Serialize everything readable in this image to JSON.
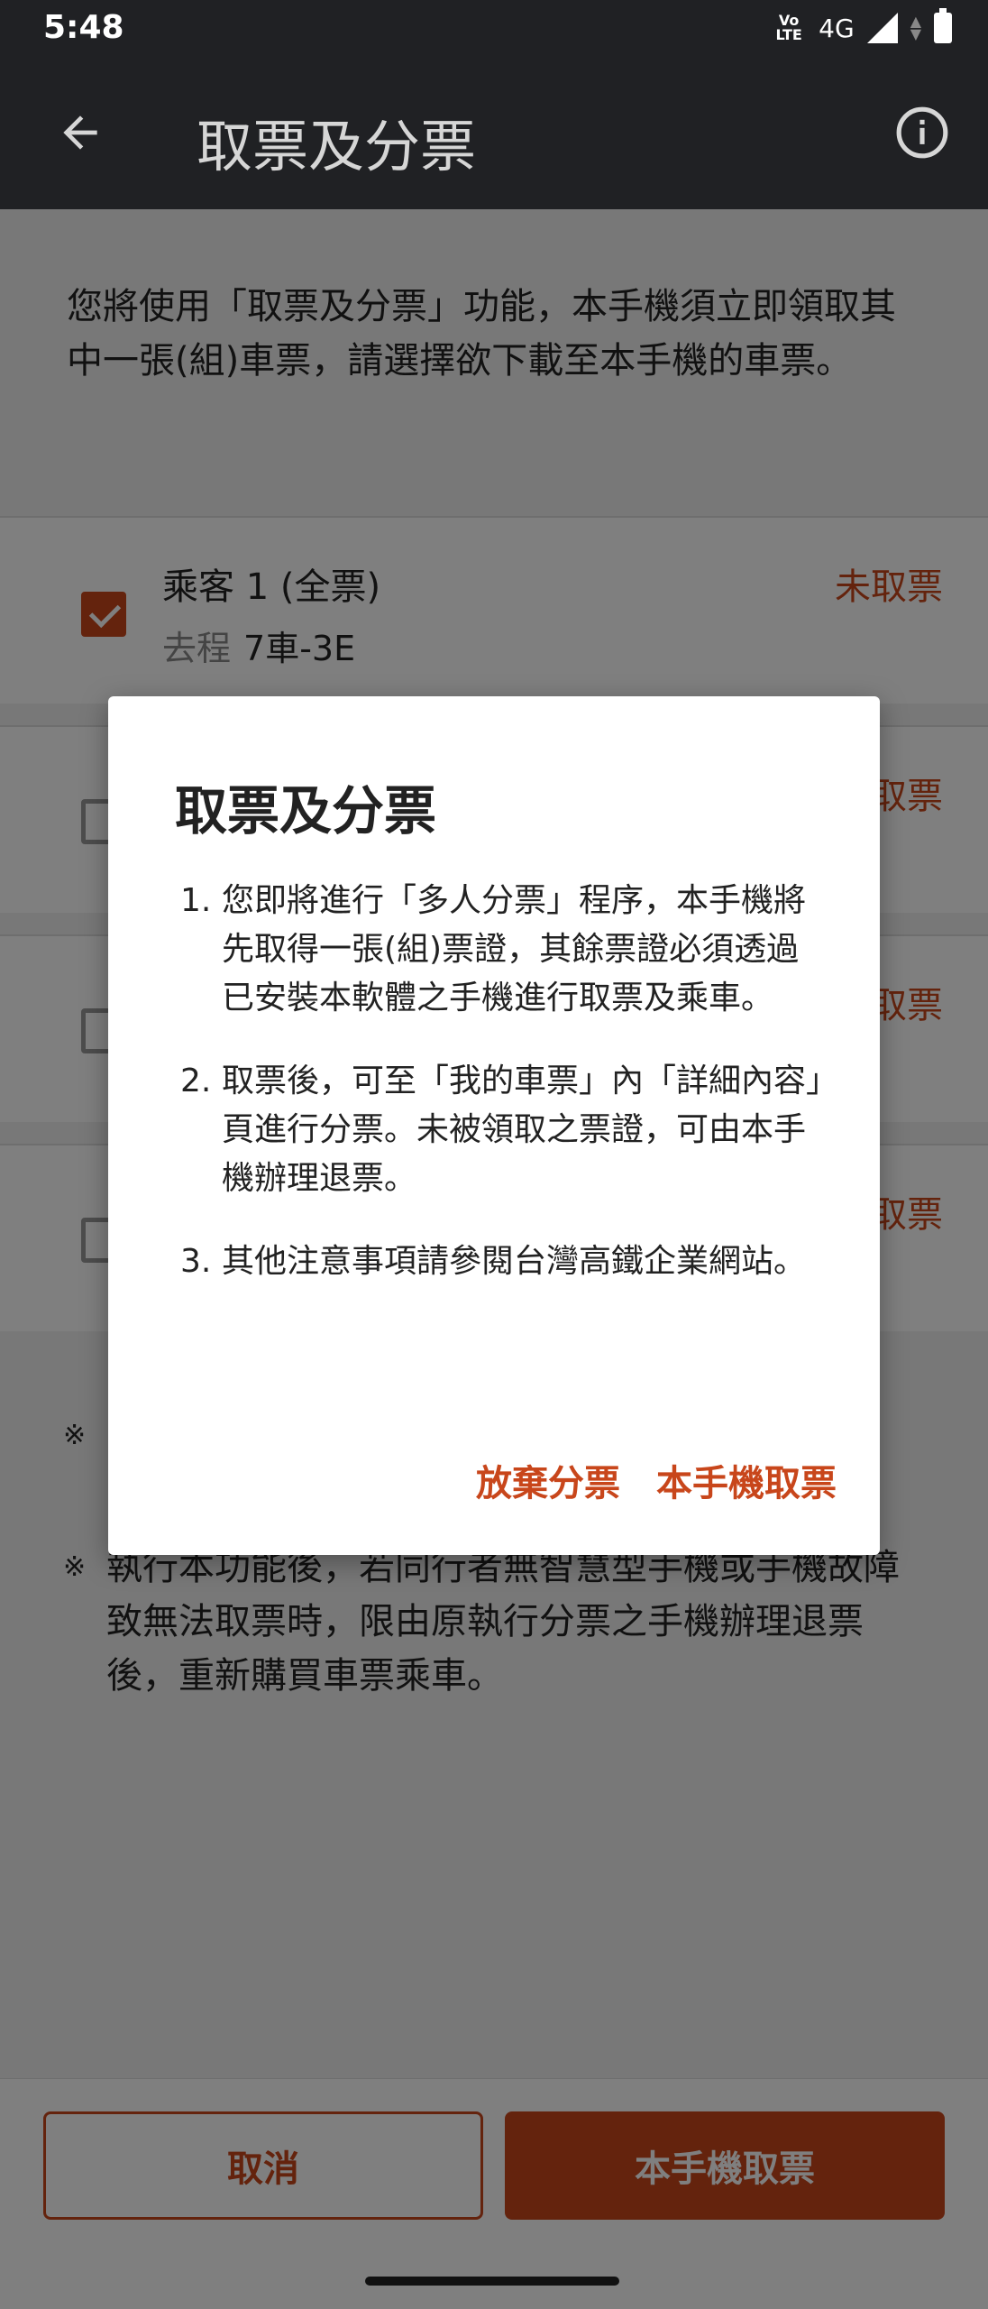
{
  "status_bar": {
    "time": "5:48",
    "volte_top": "Vo",
    "volte_bottom": "LTE",
    "network": "4G"
  },
  "app_bar": {
    "title": "取票及分票"
  },
  "intro": "您將使用「取票及分票」功能，本手機須立即領取其中一張(組)車票，請選擇欲下載至本手機的車票。",
  "passengers": [
    {
      "name": "乘客 1 (全票)",
      "direction": "去程",
      "seat": "7車-3E",
      "status": "未取票",
      "checked": true
    },
    {
      "name": "",
      "direction": "",
      "seat": "",
      "status": "取票",
      "checked": false
    },
    {
      "name": "",
      "direction": "",
      "seat": "",
      "status": "取票",
      "checked": false
    },
    {
      "name": "",
      "direction": "",
      "seat": "",
      "status": "取票",
      "checked": false
    }
  ],
  "notes": [
    {
      "mark": "※",
      "text": ""
    },
    {
      "mark": "※",
      "text": "執行本功能後，若同行者無智慧型手機或手機故障致無法取票時，限由原執行分票之手機辦理退票後，重新購買車票乘車。"
    }
  ],
  "bottom_bar": {
    "cancel_label": "取消",
    "claim_label": "本手機取票"
  },
  "dialog": {
    "title": "取票及分票",
    "items": [
      {
        "num": "1.",
        "text": "您即將進行「多人分票」程序，本手機將先取得一張(組)票證，其餘票證必須透過已安裝本軟體之手機進行取票及乘車。"
      },
      {
        "num": "2.",
        "text": "取票後，可至「我的車票」內「詳細內容」頁進行分票。未被領取之票證，可由本手機辦理退票。"
      },
      {
        "num": "3.",
        "text": "其他注意事項請參閱台灣高鐵企業網站。"
      }
    ],
    "abandon_label": "放棄分票",
    "claim_label": "本手機取票"
  },
  "colors": {
    "accent": "#c8461b",
    "app_bar": "#202124"
  },
  "icons": {
    "back": "arrow-left-icon",
    "info": "info-circle-icon"
  }
}
